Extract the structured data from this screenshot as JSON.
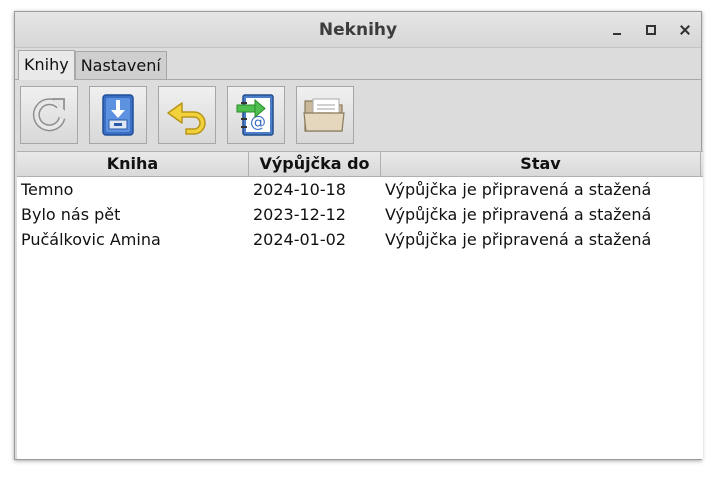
{
  "window": {
    "title": "Neknihy"
  },
  "tabs": [
    {
      "label": "Knihy",
      "active": true
    },
    {
      "label": "Nastavení",
      "active": false
    }
  ],
  "toolbar": {
    "buttons": [
      {
        "icon": "refresh-icon"
      },
      {
        "icon": "download-icon"
      },
      {
        "icon": "return-icon"
      },
      {
        "icon": "import-notebook-icon"
      },
      {
        "icon": "folder-icon"
      }
    ]
  },
  "table": {
    "columns": [
      "Kniha",
      "Výpůjčka do",
      "Stav"
    ],
    "rows": [
      [
        "Temno",
        "2024-10-18",
        "Výpůjčka je připravená a stažená"
      ],
      [
        "Bylo nás pět",
        "2023-12-12",
        "Výpůjčka je připravená a stažená"
      ],
      [
        "Pučálkovic Amina",
        "2024-01-02",
        "Výpůjčka je připravená a stažená"
      ]
    ]
  }
}
